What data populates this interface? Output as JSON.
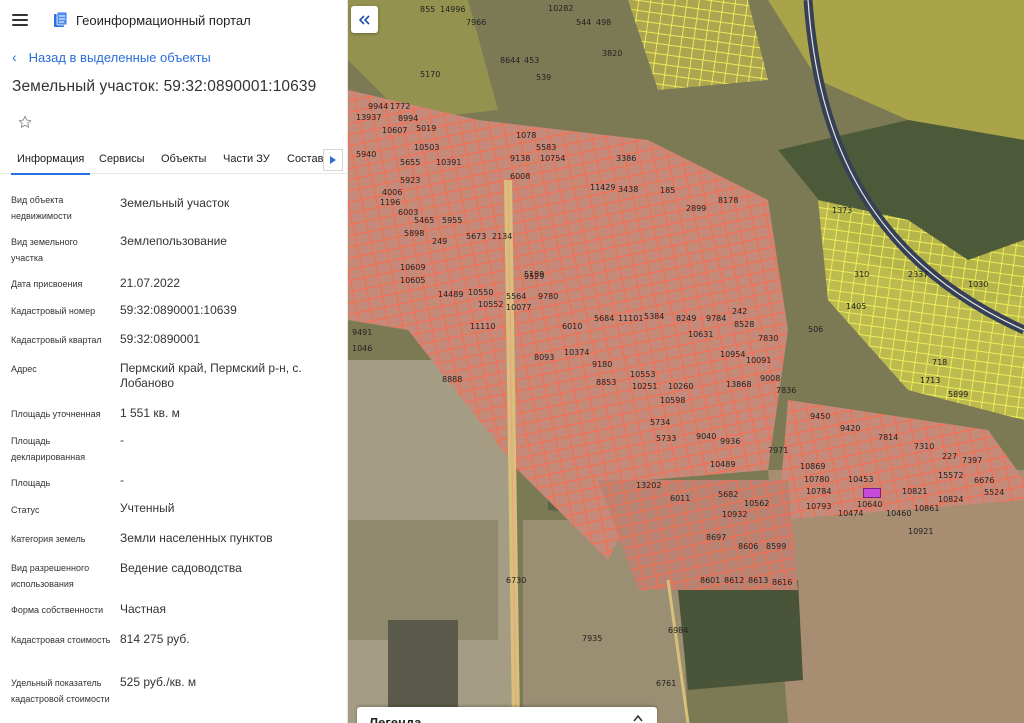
{
  "app": {
    "title": "Геоинформационный портал"
  },
  "back_link": "Назад в выделенные объекты",
  "object_title": "Земельный участок: 59:32:0890001:10639",
  "tabs": [
    {
      "label": "Информация",
      "active": true
    },
    {
      "label": "Сервисы",
      "active": false
    },
    {
      "label": "Объекты",
      "active": false
    },
    {
      "label": "Части ЗУ",
      "active": false
    },
    {
      "label": "Состав",
      "active": false
    }
  ],
  "properties": [
    {
      "label": "Вид объекта недвижимости",
      "value": "Земельный участок"
    },
    {
      "label": "Вид земельного участка",
      "value": "Землепользование"
    },
    {
      "label": "Дата присвоения",
      "value": "21.07.2022"
    },
    {
      "label": "Кадастровый номер",
      "value": "59:32:0890001:10639"
    },
    {
      "label": "Кадастровый квартал",
      "value": "59:32:0890001"
    },
    {
      "label": "Адрес",
      "value": "Пермский край, Пермский р-н, с. Лобаново"
    },
    {
      "label": "Площадь уточненная",
      "value": "1 551 кв. м"
    },
    {
      "label": "Площадь декларированная",
      "value": "-"
    },
    {
      "label": "Площадь",
      "value": "-"
    },
    {
      "label": "Статус",
      "value": "Учтенный"
    },
    {
      "label": "Категория земель",
      "value": "Земли населенных пунктов"
    },
    {
      "label": "Вид разрешенного использования",
      "value": "Ведение садоводства"
    },
    {
      "label": "Форма собственности",
      "value": "Частная"
    },
    {
      "label": "Кадастровая стоимость",
      "value": "814 275 руб."
    },
    {
      "label": "Удельный показатель кадастровой стоимости",
      "value": "525 руб./кв. м"
    }
  ],
  "map": {
    "legend_title": "Легенда",
    "selected_parcel_label": "10640",
    "parcel_labels": [
      "855",
      "14996",
      "7966",
      "10282",
      "544",
      "498",
      "5170",
      "3820",
      "8644",
      "453",
      "539",
      "1078",
      "9944",
      "1772",
      "13937",
      "8994",
      "10607",
      "5019",
      "10503",
      "10391",
      "9138",
      "10754",
      "6008",
      "5583",
      "11429",
      "3438",
      "3386",
      "185",
      "2899",
      "8178",
      "5940",
      "5923",
      "4006",
      "6003",
      "1196",
      "5655",
      "5465",
      "5955",
      "5673",
      "5898",
      "249",
      "2134",
      "10609",
      "10605",
      "14489",
      "10550",
      "10552",
      "11110",
      "10077",
      "5564",
      "9780",
      "6010",
      "5684",
      "11101",
      "5384",
      "8249",
      "9784",
      "10631",
      "9529",
      "5189",
      "8093",
      "10374",
      "9180",
      "10553",
      "10251",
      "8853",
      "10598",
      "10260",
      "13868",
      "9008",
      "10954",
      "10091",
      "5734",
      "5733",
      "9040",
      "9936",
      "10489",
      "13202",
      "6011",
      "5682",
      "10562",
      "10932",
      "8697",
      "8606",
      "8599",
      "8601",
      "8612",
      "8613",
      "8616",
      "6730",
      "7935",
      "6984",
      "6761",
      "10869",
      "10780",
      "10784",
      "10793",
      "10474",
      "10453",
      "10460",
      "10821",
      "10861",
      "10921",
      "10824",
      "15572",
      "6676",
      "5524",
      "7814",
      "7310",
      "9420",
      "227",
      "7397",
      "1373",
      "1405",
      "1713",
      "5899",
      "718",
      "506",
      "310",
      "2337",
      "1030",
      "8528",
      "7830",
      "7836",
      "9450",
      "7971",
      "1046",
      "9491",
      "8888",
      "242",
      "3528"
    ]
  }
}
